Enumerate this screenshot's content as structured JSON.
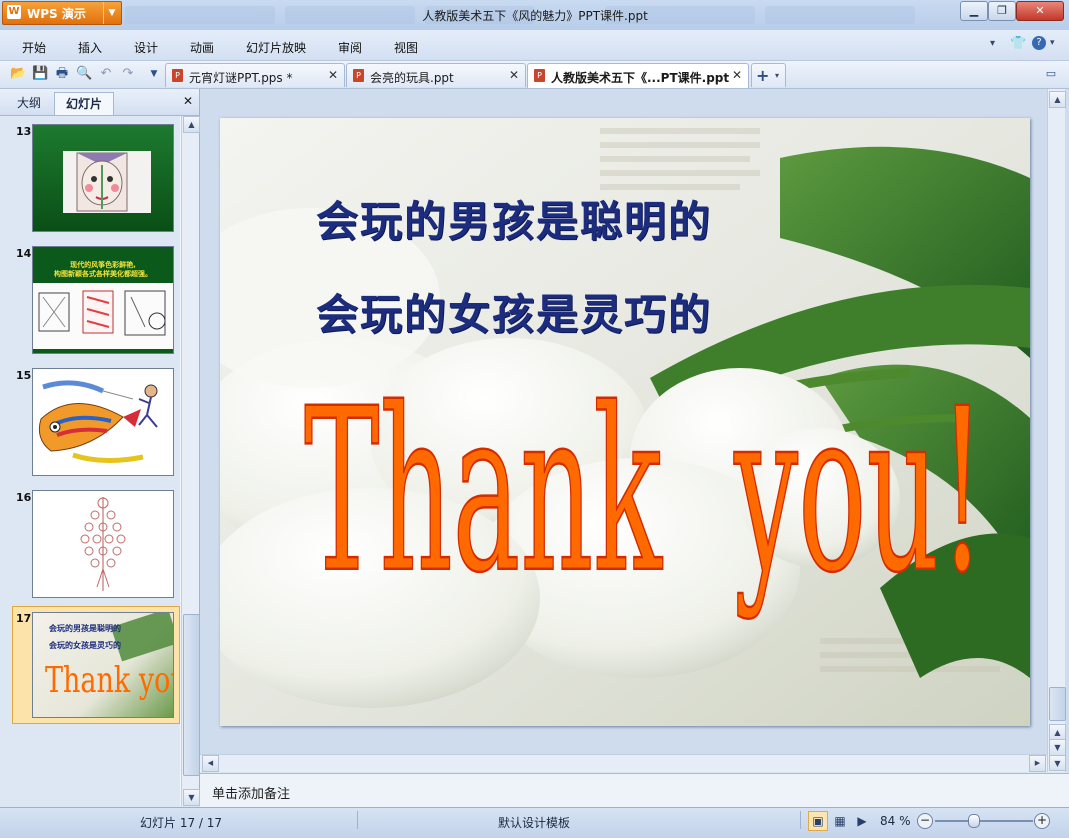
{
  "app": {
    "brand": "WPS 演示",
    "window_title": "人教版美术五下《风的魅力》PPT课件.ppt"
  },
  "menu": [
    "开始",
    "插入",
    "设计",
    "动画",
    "幻灯片放映",
    "审阅",
    "视图"
  ],
  "doc_tabs": [
    {
      "label": "元宵灯谜PPT.pps *"
    },
    {
      "label": "会亮的玩具.ppt"
    },
    {
      "label": "人教版美术五下《...PT课件.ppt"
    }
  ],
  "panel": {
    "tab_outline": "大纲",
    "tab_slides": "幻灯片",
    "close": "✕"
  },
  "thumbnails": [
    {
      "num": "13"
    },
    {
      "num": "14",
      "caption_line1": "现代的风筝色彩鲜艳,",
      "caption_line2": "构图新颖各式各样美化都超强。"
    },
    {
      "num": "15"
    },
    {
      "num": "16"
    },
    {
      "num": "17",
      "line1": "会玩的男孩是聪明的",
      "line2": "会玩的女孩是灵巧的",
      "thanks": "Thank you!"
    }
  ],
  "slide": {
    "line1": "会玩的男孩是聪明的",
    "line2": "会玩的女孩是灵巧的",
    "thanks": "Thank  you!"
  },
  "notes": {
    "placeholder": "单击添加备注"
  },
  "status": {
    "slide_counter": "幻灯片 17 / 17",
    "template": "默认设计模板",
    "zoom": "84 %"
  },
  "colors": {
    "accent": "#e0700c",
    "slide_text_blue": "#1c2c7e",
    "thanks_orange": "#ff6a00",
    "thumb_green": "#0b5a1c"
  }
}
